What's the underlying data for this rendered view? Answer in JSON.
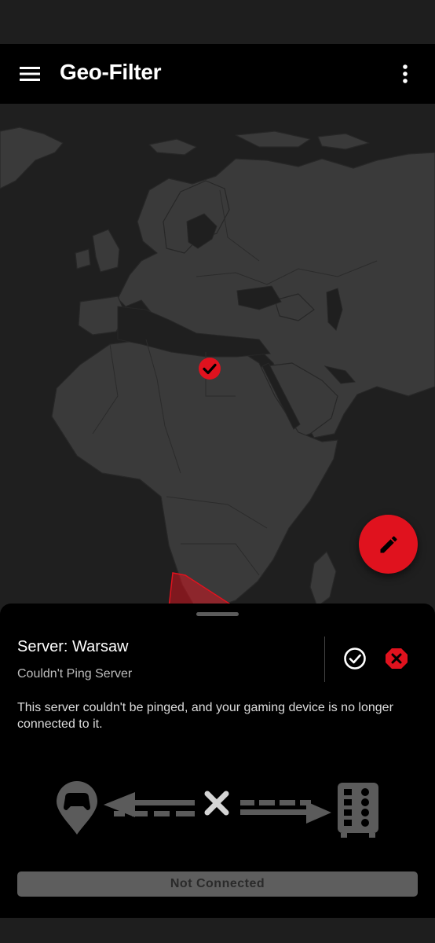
{
  "app_bar": {
    "title": "Geo-Filter",
    "menu_icon": "hamburger-menu-icon",
    "overflow_icon": "more-vert-icon"
  },
  "map": {
    "land_color": "#3a3a3a",
    "border_color": "#272727",
    "water_color": "#1f1f1f",
    "selected_server_icon": "check-circle-marker-icon",
    "filter_region_color": "#e0121e"
  },
  "fab": {
    "icon": "pencil-edit-icon",
    "color": "#e0121e"
  },
  "sheet": {
    "server_title": "Server: Warsaw",
    "server_status": "Couldn't Ping Server",
    "description": "This server couldn't be pinged, and your gaming device is no longer connected to it.",
    "accept_icon": "check-circle-outline-icon",
    "reject_icon": "hexagon-x-icon",
    "connection_button": "Not Connected",
    "illustration": {
      "device_icon": "gamepad-location-pin-icon",
      "status_icon": "x-disconnected-icon",
      "server_icon": "server-rack-icon"
    }
  }
}
